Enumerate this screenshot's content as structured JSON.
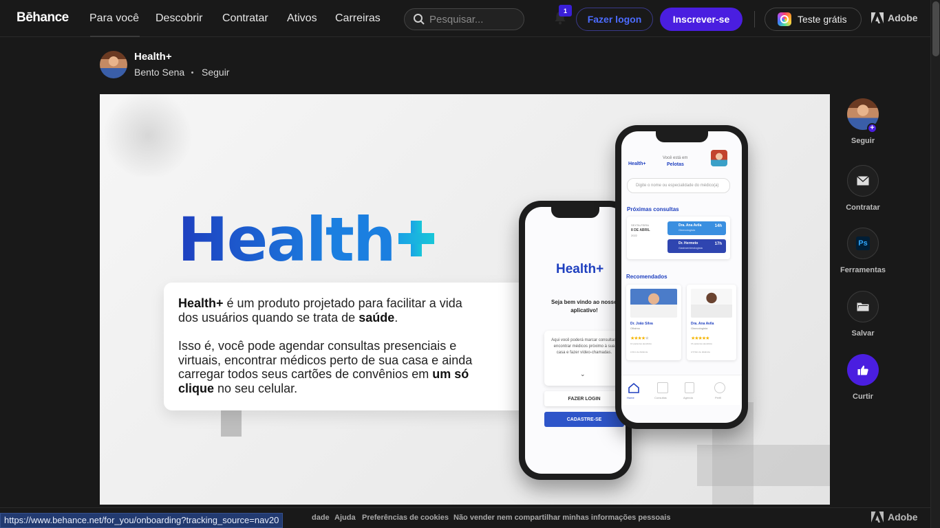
{
  "nav": {
    "logo": "Bēhance",
    "links": [
      "Para você",
      "Descobrir",
      "Contratar",
      "Ativos",
      "Carreiras"
    ],
    "search_placeholder": "Pesquisar...",
    "notification_count": "1",
    "login": "Fazer logon",
    "signup": "Inscrever-se",
    "trial": "Teste grátis",
    "adobe": "Adobe"
  },
  "project": {
    "title": "Health+",
    "owner": "Bento Sena",
    "follow": "Seguir"
  },
  "hero": {
    "title": "Health",
    "card_p1_bold": "Health+",
    "card_p1_a": " é um produto projetado para facilitar a vida dos usuários quando se trata de ",
    "card_p1_bold2": "saúde",
    "card_p1_b": ".",
    "card_p2_a": "Isso é, você pode agendar consultas presenciais e virtuais, encontrar médicos perto de sua casa e ainda carregar todos seus cartões de convênios em ",
    "card_p2_bold": "um só clique",
    "card_p2_b": " no seu celular.",
    "phone_left": {
      "brand": "Health+",
      "welcome": "Seja bem vindo ao nosso aplicativo!",
      "desc": "Aqui você poderá marcar consultas, encontrar médicos próximo à sua casa e fazer vídeo-chamadas.",
      "login": "FAZER LOGIN",
      "signup": "CADASTRE-SE"
    },
    "phone_right": {
      "brand": "Health+",
      "location_label": "Você está em",
      "location": "Pelotas",
      "search": "Digite o nome ou especialidade do médico(a)",
      "next_title": "Próximas consultas",
      "date_day": "SEXTA-FEIRA",
      "date": "8 DE ABRIL",
      "year": "2022",
      "appt1_name": "Dra. Ana Avila",
      "appt1_spec": "Ginecologista",
      "appt1_time": "14h",
      "appt2_name": "Dr. Hermeto",
      "appt2_spec": "Gastroenterologista",
      "appt2_time": "17h",
      "recommended": "Recomendados",
      "doc1_name": "Dr. João Silva",
      "doc1_spec": "Oftalmo",
      "doc1_reviews": "10 pacientes atendidos",
      "doc1_dist": "A 3km de distância",
      "doc2_name": "Dra. Ana Avila",
      "doc2_spec": "Ginecologista",
      "doc2_reviews": "15 pacientes atendidos",
      "doc2_dist": "A 5,5km de distância",
      "tabs": [
        "Home",
        "Consultas",
        "Agenda",
        "Perfil"
      ]
    }
  },
  "sidebar": {
    "follow": "Seguir",
    "hire": "Contratar",
    "tools": "Ferramentas",
    "tools_icon_text": "Ps",
    "save": "Salvar",
    "like": "Curtir"
  },
  "footer": {
    "links": [
      "dade",
      "Ajuda",
      "Preferências de cookies",
      "Não vender nem compartilhar minhas informações pessoais"
    ],
    "adobe": "Adobe",
    "status_url": "https://www.behance.net/for_you/onboarding?tracking_source=nav20"
  },
  "colors": {
    "accent": "#4a1ee0",
    "link_blue": "#4c6cff",
    "health_blue": "#1e3fbf",
    "health_cyan": "#19c6d8"
  }
}
